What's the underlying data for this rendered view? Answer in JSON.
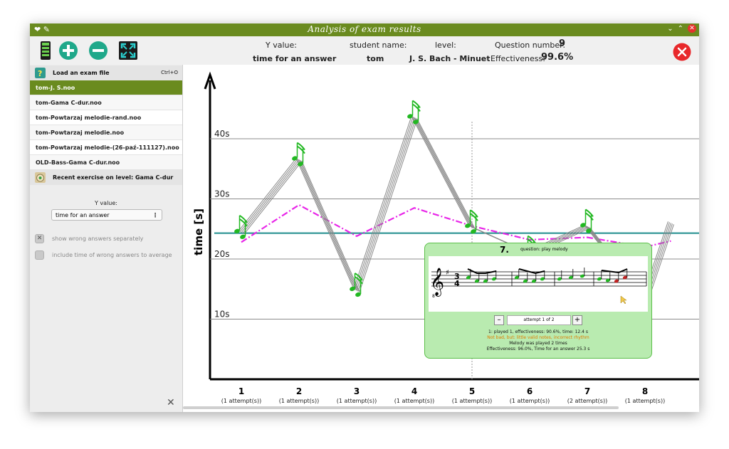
{
  "window": {
    "title": "Analysis of exam results"
  },
  "toolbar": {
    "y_value_label": "Y value:",
    "y_value": "time for an answer",
    "student_label": "student name:",
    "student": "tom",
    "level_label": "level:",
    "level": "J. S. Bach - Minuet",
    "question_label": "Question number:",
    "question_number": "9",
    "effectiveness_label": "Effectiveness:",
    "effectiveness": "99.6%"
  },
  "sidebar": {
    "load_label": "Load an exam file",
    "load_shortcut": "Ctrl+O",
    "files": [
      "tom-J. S.noo",
      "tom-Gama C-dur.noo",
      "tom-Powtarzaj melodie-rand.noo",
      "tom-Powtarzaj melodie.noo",
      "tom-Powtarzaj melodie-(26-paź-111127).noo",
      "OLD-Bass-Gama C-dur.noo"
    ],
    "recent_label": "Recent exercise on level: Gama C-dur",
    "yvalue_label": "Y value:",
    "yvalue_selected": "time for an answer",
    "show_wrong": "show wrong answers separately",
    "include_time": "include time of wrong answers to average",
    "close_glyph": "✕"
  },
  "chart_data": {
    "type": "line",
    "ylabel": "time [s]",
    "yticks": [
      "10s",
      "20s",
      "30s",
      "40s"
    ],
    "ylim": [
      0,
      47
    ],
    "x": [
      1,
      2,
      3,
      4,
      5,
      6,
      7,
      8
    ],
    "xlabels": [
      "1",
      "2",
      "3",
      "4",
      "5",
      "6",
      "7",
      "8"
    ],
    "attempt_labels": [
      "(1 attempt(s))",
      "(1 attempt(s))",
      "(1 attempt(s))",
      "(1 attempt(s))",
      "(1 attempt(s))",
      "(1 attempt(s))",
      "(2 attempt(s))",
      "(1 attempt(s))"
    ],
    "answer_times": [
      24.4,
      36.5,
      14.8,
      43.5,
      25.3,
      21.0,
      25.4,
      13.2,
      26.0
    ],
    "answer_positions": [
      1,
      2,
      3,
      4,
      5,
      6,
      7,
      8,
      8.45
    ],
    "average": 24.3,
    "moving_average": [
      22.8,
      29.0,
      23.8,
      28.5,
      25.5,
      23.2,
      23.6,
      22.0,
      23.0
    ],
    "moving_average_positions": [
      1,
      2,
      3,
      4,
      5,
      6,
      7,
      8,
      8.45
    ],
    "colors": {
      "average": "#1e8c8c",
      "moving_average": "#e826e8",
      "answer_line": "#8a8a8a",
      "note": "#22b822"
    }
  },
  "popup": {
    "number": "7.",
    "question": "question: play melody",
    "attempt": "attempt 1 of 2",
    "minus": "–",
    "plus": "+",
    "line1": "1: played 1, effectiveness: 90.6%, time: 12.4 s",
    "line2": "Not bad, but: little valid notes, incorrect rhythm",
    "line3": "Melody was played 2 times",
    "line4": "Effectiveness: 96.0%, Time for an answer 25.3 s"
  }
}
